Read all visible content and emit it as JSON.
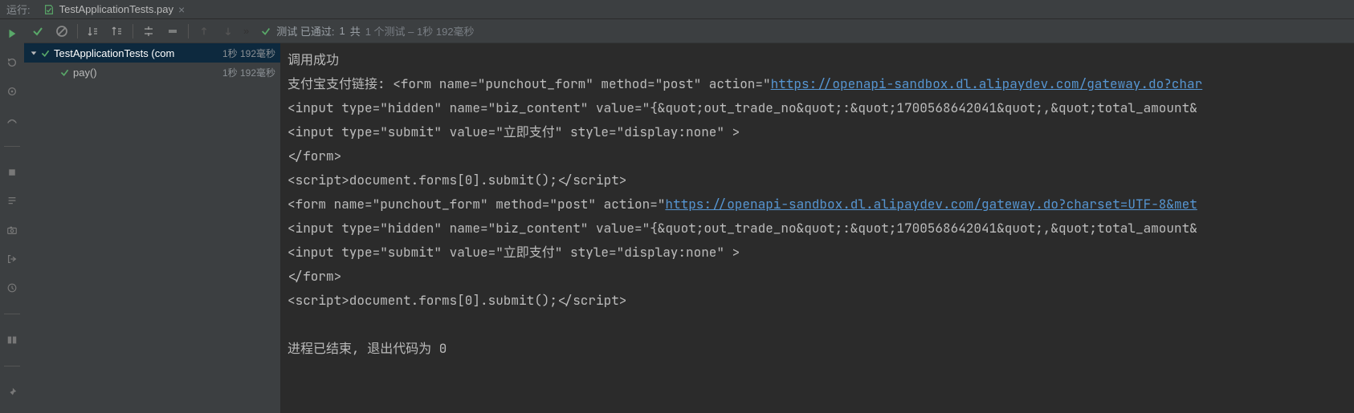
{
  "tabbar": {
    "run_label": "运行:",
    "tab_name": "TestApplicationTests.pay",
    "close_glyph": "×"
  },
  "toolbar": {
    "status_prefix": "测试 已通过:",
    "status_count": "1",
    "status_suffix_plain": "共",
    "status_grey": "1 个测试 – 1秒 192毫秒",
    "chev": "»"
  },
  "tree": {
    "root": {
      "name": "TestApplicationTests (com",
      "time": "1秒 192毫秒"
    },
    "child": {
      "name": "pay()",
      "time": "1秒 192毫秒"
    }
  },
  "console": {
    "l1": "调用成功",
    "l2a": "支付宝支付链接: <form name=\"punchout_form\" method=\"post\" action=\"",
    "l2link": "https://openapi-sandbox.dl.alipaydev.com/gateway.do?char",
    "l3": "<input type=\"hidden\" name=\"biz_content\" value=\"{&quot;out_trade_no&quot;:&quot;1700568642041&quot;,&quot;total_amount&",
    "l4": "<input type=\"submit\" value=\"立即支付\" style=\"display:none\" >",
    "l5": "</form>",
    "l6": "<script>document.forms[0].submit();</script>",
    "l7a": "<form name=\"punchout_form\" method=\"post\" action=\"",
    "l7link": "https://openapi-sandbox.dl.alipaydev.com/gateway.do?charset=UTF-8&met",
    "l8": "<input type=\"hidden\" name=\"biz_content\" value=\"{&quot;out_trade_no&quot;:&quot;1700568642041&quot;,&quot;total_amount&",
    "l9": "<input type=\"submit\" value=\"立即支付\" style=\"display:none\" >",
    "l10": "</form>",
    "l11": "<script>document.forms[0].submit();</script>",
    "l13": "进程已结束, 退出代码为 0"
  }
}
